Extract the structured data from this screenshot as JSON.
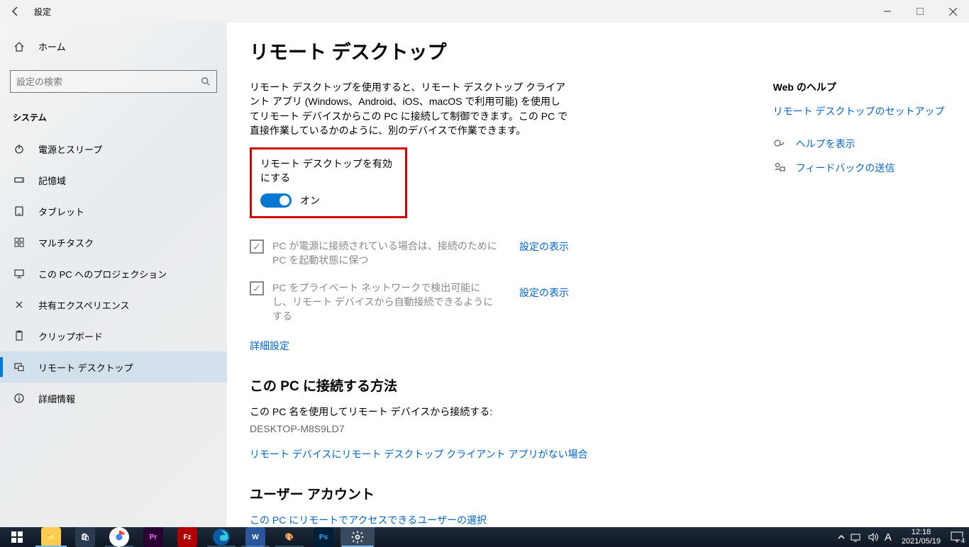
{
  "titlebar": {
    "title": "設定"
  },
  "sidebar": {
    "home": "ホーム",
    "search_placeholder": "設定の検索",
    "section": "システム",
    "items": [
      {
        "label": "電源とスリープ",
        "icon": "power"
      },
      {
        "label": "記憶域",
        "icon": "storage"
      },
      {
        "label": "タブレット",
        "icon": "tablet"
      },
      {
        "label": "マルチタスク",
        "icon": "multitask"
      },
      {
        "label": "この PC へのプロジェクション",
        "icon": "projection"
      },
      {
        "label": "共有エクスペリエンス",
        "icon": "shared"
      },
      {
        "label": "クリップボード",
        "icon": "clipboard"
      },
      {
        "label": "リモート デスクトップ",
        "icon": "remote",
        "active": true
      },
      {
        "label": "詳細情報",
        "icon": "info"
      }
    ]
  },
  "content": {
    "heading": "リモート デスクトップ",
    "description": "リモート デスクトップを使用すると、リモート デスクトップ クライアント アプリ (Windows、Android、iOS、macOS で利用可能) を使用してリモート デバイスからこの PC に接続して制御できます。この PC で直接作業しているかのように、別のデバイスで作業できます。",
    "toggle_label": "リモート デスクトップを有効にする",
    "toggle_state": "オン",
    "check1": "PC が電源に接続されている場合は、接続のために PC を起動状態に保つ",
    "check2": "PC をプライベート ネットワークで検出可能にし、リモート デバイスから自動接続できるようにする",
    "show_settings": "設定の表示",
    "advanced": "詳細設定",
    "connect_h": "この PC に接続する方法",
    "connect_desc": "この PC 名を使用してリモート デバイスから接続する:",
    "pc_name": "DESKTOP-M8S9LD7",
    "no_client": "リモート デバイスにリモート デスクトップ クライアント アプリがない場合",
    "users_h": "ユーザー アカウント",
    "users_link": "この PC にリモートでアクセスできるユーザーの選択"
  },
  "right": {
    "help_h": "Web のヘルプ",
    "setup_link": "リモート デスクトップのセットアップ",
    "show_help": "ヘルプを表示",
    "send_feedback": "フィードバックの送信"
  },
  "taskbar": {
    "time": "12:18",
    "date": "2021/05/19",
    "ime": "A",
    "badge": "4"
  }
}
